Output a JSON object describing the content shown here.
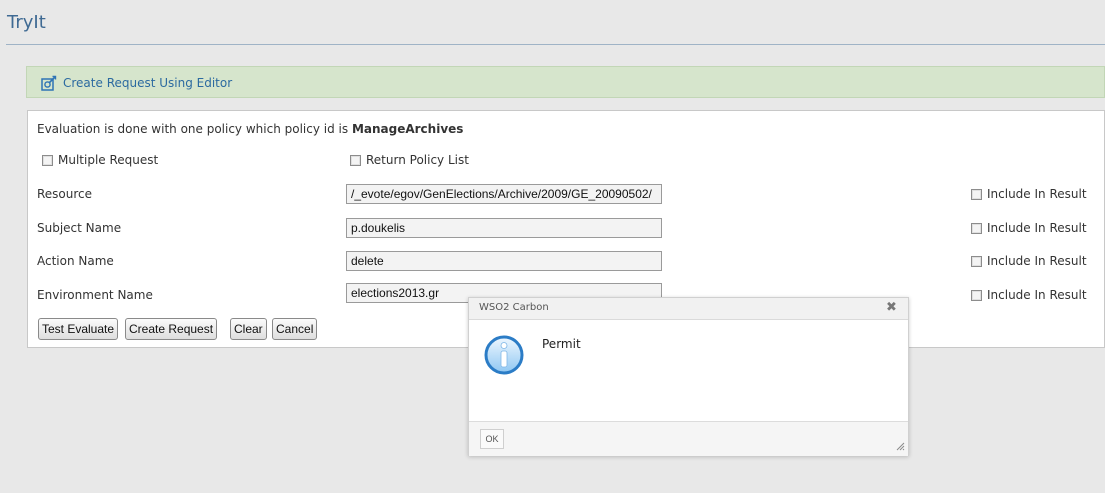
{
  "header": {
    "title": "TryIt"
  },
  "editor": {
    "link_label": "Create Request Using Editor",
    "icon": "editor-icon"
  },
  "form": {
    "evaluation_prefix": "Evaluation is done with one policy which policy id is ",
    "policy_id": "ManageArchives",
    "multiple_request_label": "Multiple Request",
    "return_policy_list_label": "Return Policy List",
    "rows": [
      {
        "label": "Resource",
        "value": "/_evote/egov/GenElections/Archive/2009/GE_20090502/",
        "include_label": "Include In Result"
      },
      {
        "label": "Subject Name",
        "value": "p.doukelis",
        "include_label": "Include In Result"
      },
      {
        "label": "Action Name",
        "value": "delete",
        "include_label": "Include In Result"
      },
      {
        "label": "Environment Name",
        "value": "elections2013.gr",
        "include_label": "Include In Result"
      }
    ],
    "buttons": {
      "test_evaluate": "Test Evaluate",
      "create_request": "Create Request",
      "clear": "Clear",
      "cancel": "Cancel"
    }
  },
  "dialog": {
    "title": "WSO2 Carbon",
    "close_glyph": "✖",
    "message": "Permit",
    "ok_label": "OK",
    "icon": "info-icon"
  }
}
